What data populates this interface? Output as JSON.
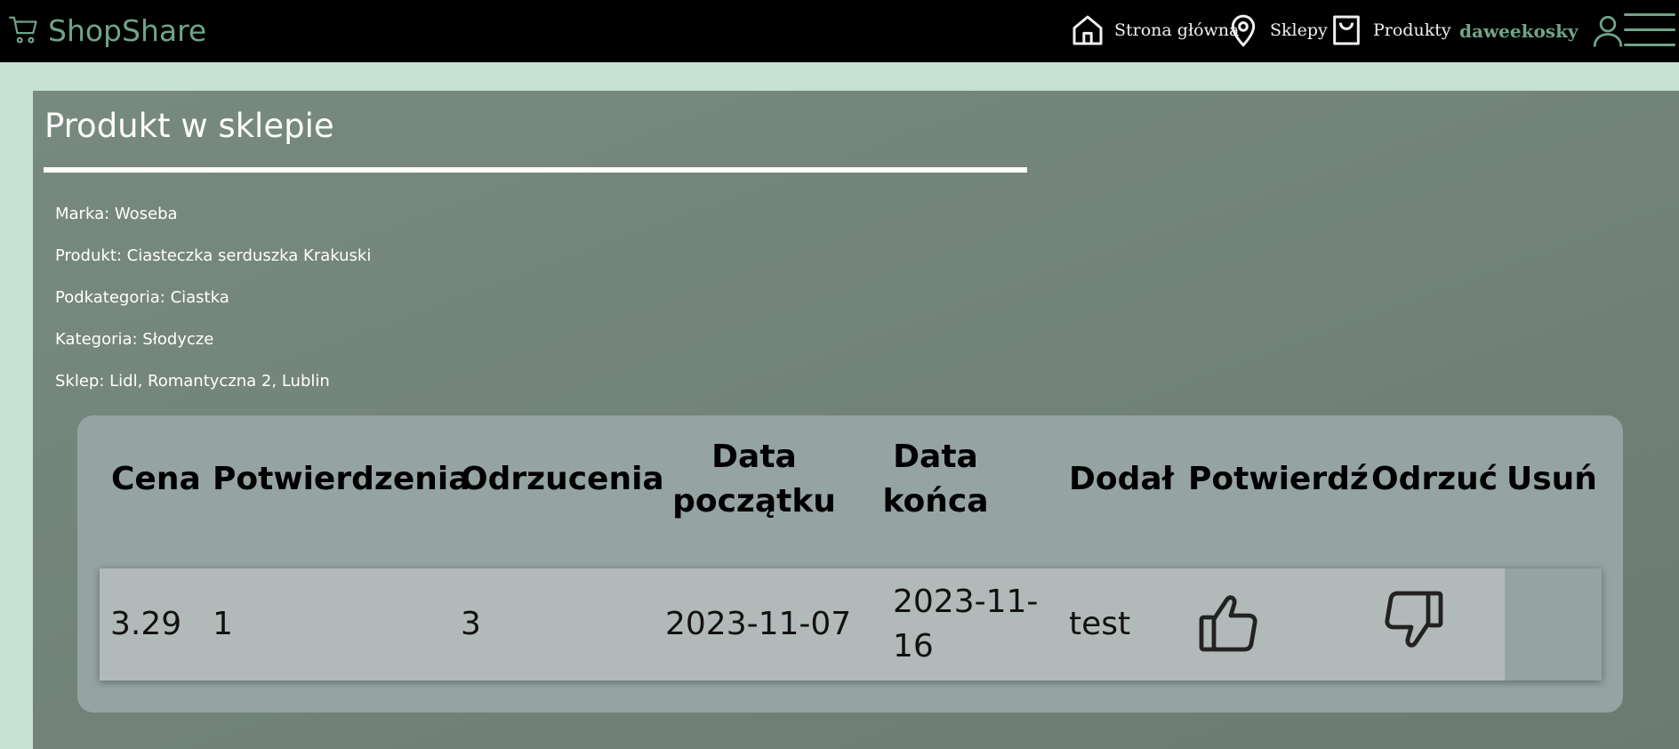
{
  "app": {
    "brand": "ShopShare"
  },
  "nav": {
    "home": "Strona główna",
    "shops": "Sklepy",
    "products": "Produkty",
    "username": "daweekosky"
  },
  "page": {
    "title": "Produkt w sklepie",
    "brand_line": "Marka: Woseba",
    "product_line": "Produkt: Ciasteczka serduszka Krakuski",
    "subcategory_line": "Podkategoria: Ciastka",
    "category_line": "Kategoria: Słodycze",
    "shop_line": "Sklep: Lidl, Romantyczna 2, Lublin"
  },
  "table": {
    "headers": {
      "price": "Cena",
      "confirmations": "Potwierdzenia",
      "rejections": "Odrzucenia",
      "start_1": "Data",
      "start_2": "początku",
      "end_1": "Data",
      "end_2": "końca",
      "added_by": "Dodał",
      "confirm": "Potwierdź",
      "reject": "Odrzuć",
      "delete": "Usuń"
    },
    "rows": [
      {
        "price": "3.29",
        "confirmations": "1",
        "rejections": "3",
        "start_date": "2023-11-07",
        "end_date_1": "2023-11-",
        "end_date_2": "16",
        "added_by": "test"
      }
    ]
  },
  "icons": {
    "cart": "cart-icon",
    "home": "home-icon",
    "location": "map-pin-icon",
    "bag": "shopping-bag-icon",
    "user": "user-icon",
    "menu": "hamburger-menu-icon",
    "confirm": "thumbs-up-icon",
    "reject": "thumbs-down-icon"
  },
  "colors": {
    "accent": "#6fa489",
    "navbar": "#000000",
    "page_bg": "#c5e1d2",
    "panel": "#728078",
    "card": "#95a3a3",
    "row": "#b2bab9"
  }
}
